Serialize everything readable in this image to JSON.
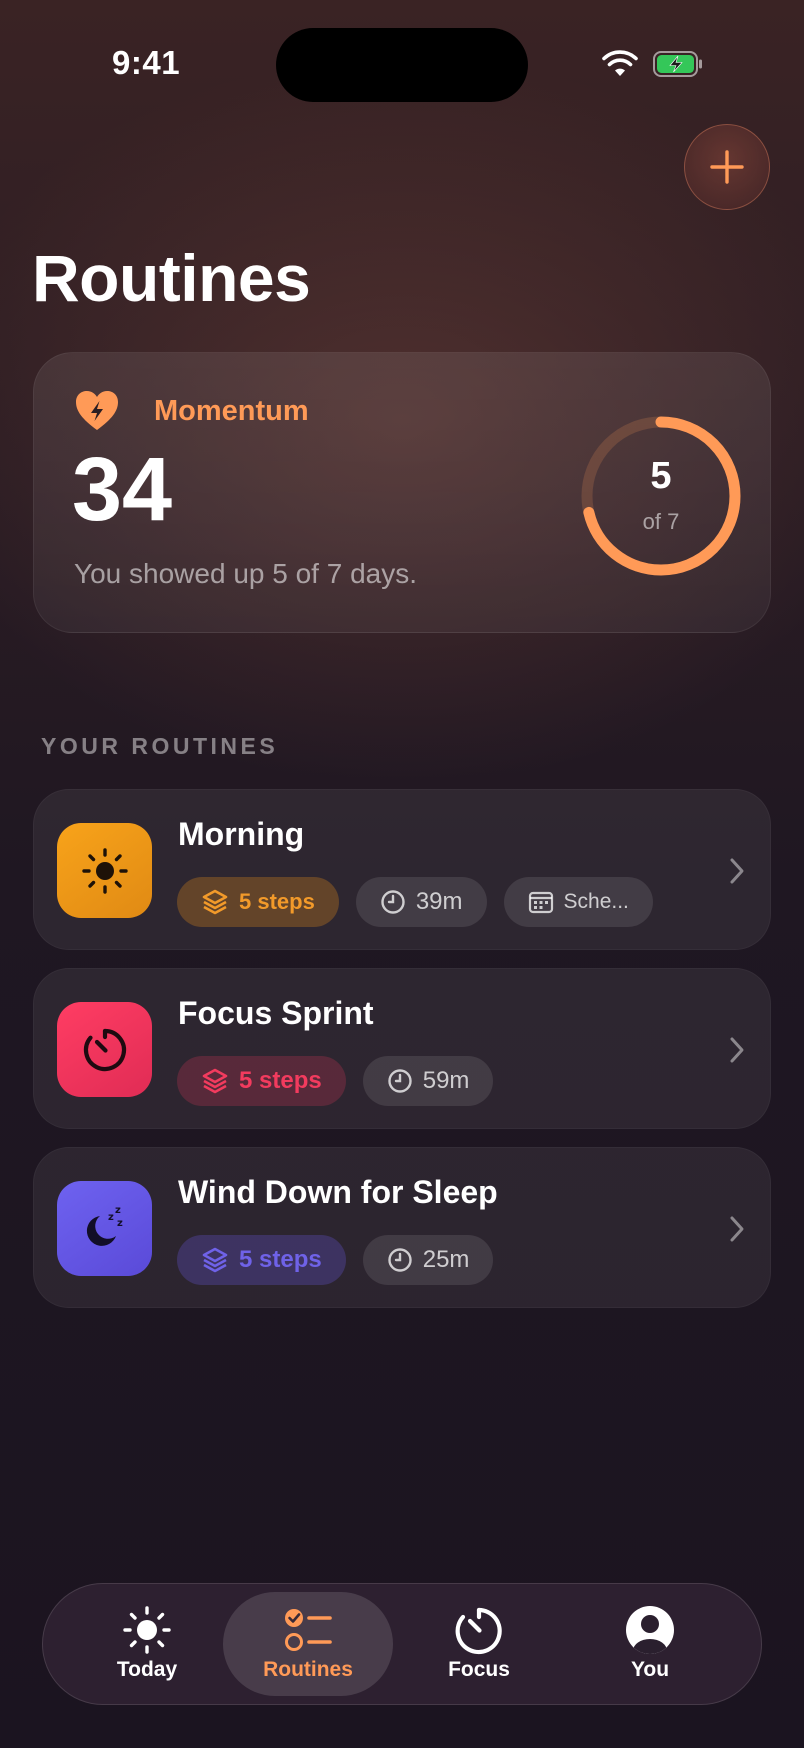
{
  "status_bar": {
    "time": "9:41"
  },
  "header": {
    "title": "Routines",
    "add_icon": "plus-icon"
  },
  "momentum": {
    "label": "Momentum",
    "icon": "heart-bolt-icon",
    "value": "34",
    "subtitle": "You showed up 5 of 7 days.",
    "ring_number": "5",
    "ring_caption": "of 7",
    "progress": 0.714
  },
  "section_header": "YOUR ROUTINES",
  "routines": [
    {
      "title": "Morning",
      "icon": "sun-icon",
      "accent": "#f29318",
      "steps": "5 steps",
      "duration": "39m",
      "schedule": "Sche..."
    },
    {
      "title": "Focus Sprint",
      "icon": "timer-icon",
      "accent": "#f23b5e",
      "steps": "5 steps",
      "duration": "59m"
    },
    {
      "title": "Wind Down for Sleep",
      "icon": "moon-zzz-icon",
      "accent": "#6a5ae6",
      "steps": "5 steps",
      "duration": "25m"
    }
  ],
  "tabs": [
    {
      "label": "Today",
      "icon": "sun-icon",
      "active": false
    },
    {
      "label": "Routines",
      "icon": "checklist-icon",
      "active": true
    },
    {
      "label": "Focus",
      "icon": "timer-icon",
      "active": false
    },
    {
      "label": "You",
      "icon": "person-icon",
      "active": false
    }
  ],
  "colors": {
    "accent": "#ff9a57",
    "background": "#1b1420"
  }
}
